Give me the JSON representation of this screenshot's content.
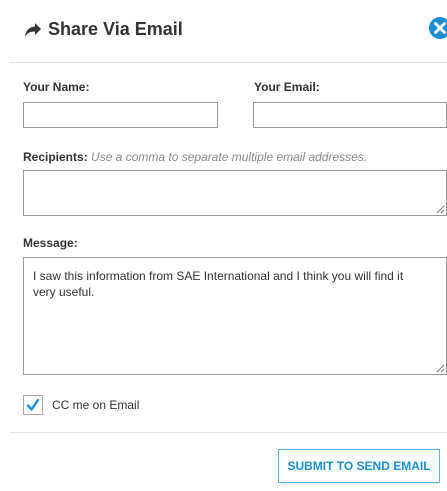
{
  "dialog": {
    "title": "Share Via Email",
    "icons": {
      "share": "share-arrow-icon",
      "close": "close-circle-icon"
    },
    "accent_color": "#1a8fd3"
  },
  "form": {
    "your_name": {
      "label": "Your Name:",
      "value": ""
    },
    "your_email": {
      "label": "Your Email:",
      "value": ""
    },
    "recipients": {
      "label": "Recipients:",
      "hint": "Use a comma to separate multiple email addresses.",
      "value": ""
    },
    "message": {
      "label": "Message:",
      "value": "I saw this information from SAE International and I think you will find it very useful."
    },
    "cc_me": {
      "label": "CC me on Email",
      "checked": true
    },
    "submit_label": "SUBMIT TO SEND EMAIL"
  }
}
